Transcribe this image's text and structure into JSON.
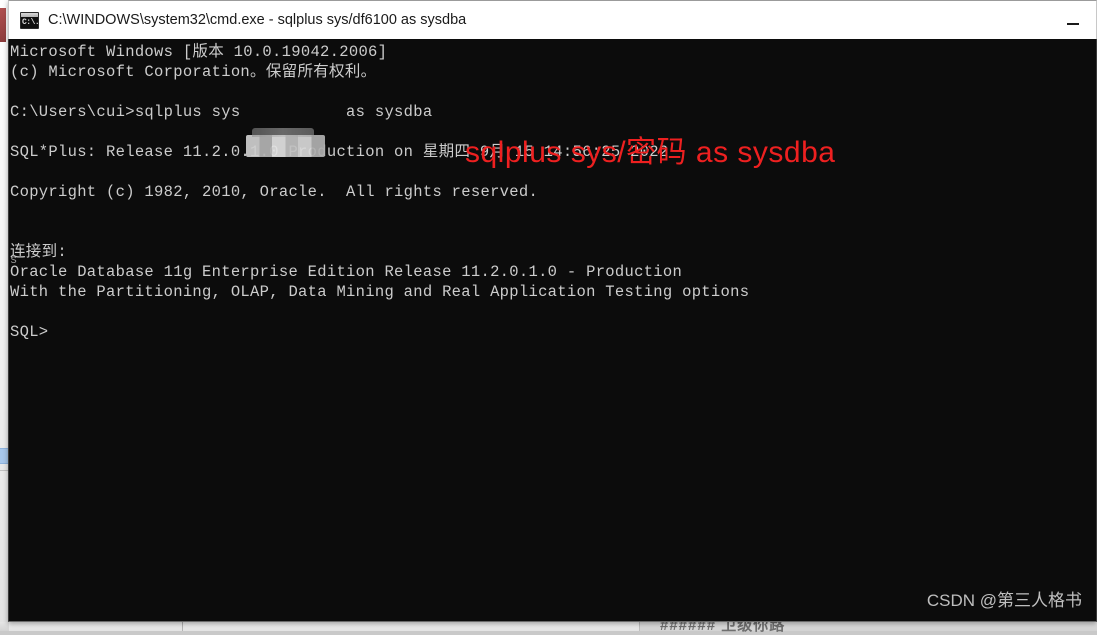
{
  "window": {
    "title": "C:\\WINDOWS\\system32\\cmd.exe - sqlplus  sys/df6100 as sysdba",
    "icon_name": "cmd-console-icon",
    "icon_glyph": "C:\\.",
    "minimize_label": "—",
    "background_color": "#0c0c0c",
    "text_color": "#cccccc",
    "titlebar_color": "#ffffff"
  },
  "terminal": {
    "lines": [
      "Microsoft Windows [版本 10.0.19042.2006]",
      "(c) Microsoft Corporation。保留所有权利。",
      "",
      "C:\\Users\\cui>sqlplus sys           as sysdba",
      "",
      "SQL*Plus: Release 11.2.0.1.0 Production on 星期四 9月 15 14:56:25 2022",
      "",
      "Copyright (c) 1982, 2010, Oracle.  All rights reserved.",
      "",
      "",
      "连接到:",
      "Oracle Database 11g Enterprise Edition Release 11.2.0.1.0 - Production",
      "With the Partitioning, OLAP, Data Mining and Real Application Testing options",
      "",
      "SQL>"
    ],
    "full_text": "Microsoft Windows [版本 10.0.19042.2006]\n(c) Microsoft Corporation。保留所有权利。\n\nC:\\Users\\cui>sqlplus sys           as sysdba\n\nSQL*Plus: Release 11.2.0.1.0 Production on 星期四 9月 15 14:56:25 2022\n\nCopyright (c) 1982, 2010, Oracle.  All rights reserved.\n\n\n连接到:\nOracle Database 11g Enterprise Edition Release 11.2.0.1.0 - Production\nWith the Partitioning, OLAP, Data Mining and Real Application Testing options\n\nSQL>",
    "prompt": "SQL>",
    "redaction_note": "password mosaic block"
  },
  "annotation": {
    "text": "sqlplus sys/密码 as sysdba",
    "color": "#ee2020"
  },
  "stray": {
    "left_edge_char": "s"
  },
  "background": {
    "ghost_text": "###### 卫级你路"
  },
  "watermark": {
    "text": "CSDN @第三人格书",
    "color": "#d2d2d2"
  }
}
